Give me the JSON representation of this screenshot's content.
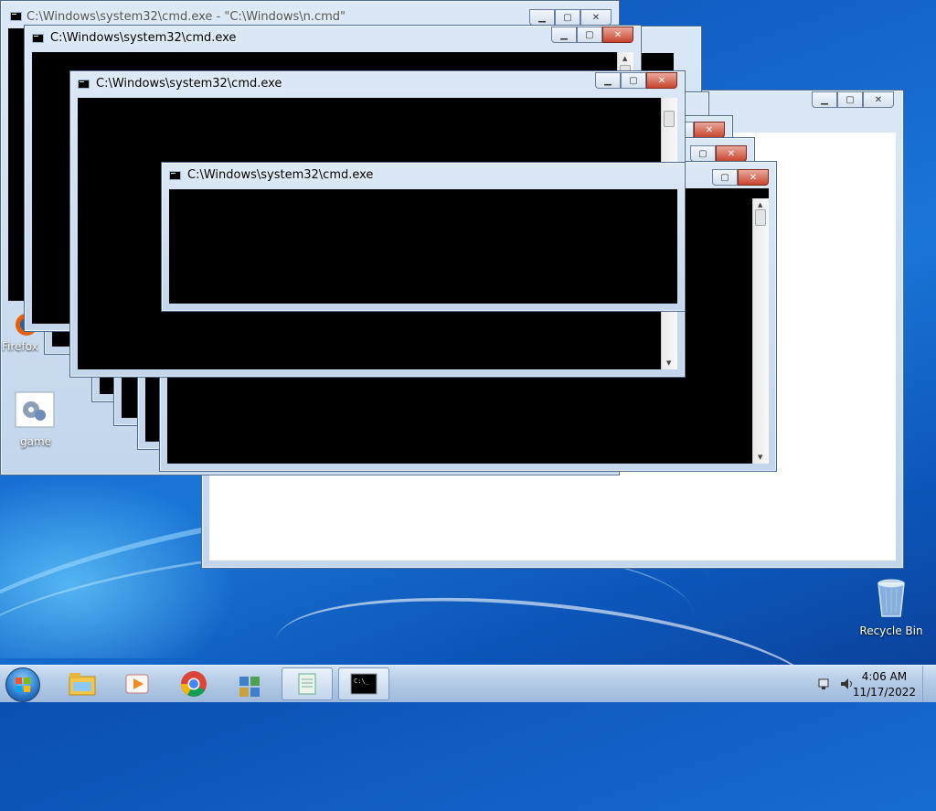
{
  "desktop": {
    "icons": [
      {
        "label": "Firefox"
      },
      {
        "label": "game"
      },
      {
        "label": "Recycle Bin"
      }
    ]
  },
  "windows": {
    "back_cmd": {
      "title": "C:\\Windows\\system32\\cmd.exe - \"C:\\Windows\\n.cmd\""
    },
    "cmd1": {
      "title": "C:\\Windows\\system32\\cmd.exe"
    },
    "cmd2": {
      "title": "C:\\Windows\\system32\\cmd.exe"
    },
    "cmd3": {
      "title": "C:\\Windows\\system32\\cmd.exe"
    }
  },
  "controls": {
    "minimize": "▁",
    "maximize": "▢",
    "close": "✕"
  },
  "taskbar": {
    "items": [
      "file-explorer",
      "media-player",
      "chrome",
      "game-app",
      "notepad",
      "command-prompt"
    ],
    "clock_time": "4:06 AM",
    "clock_date": "11/17/2022"
  },
  "colors": {
    "close_red": "#c8452f",
    "desktop_blue": "#1566cc"
  }
}
